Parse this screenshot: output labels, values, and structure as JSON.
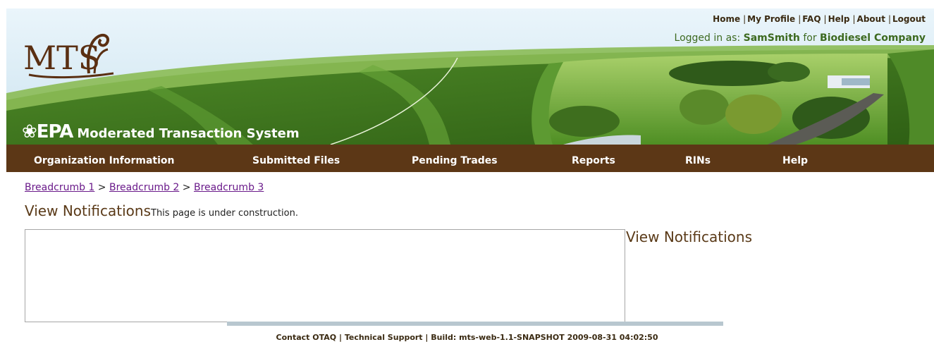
{
  "header": {
    "logo_text": "MTS",
    "agency": "EPA",
    "system_name": "Moderated Transaction System"
  },
  "top_links": [
    {
      "label": "Home"
    },
    {
      "label": "My Profile"
    },
    {
      "label": "FAQ"
    },
    {
      "label": "Help"
    },
    {
      "label": "About"
    },
    {
      "label": "Logout"
    }
  ],
  "login": {
    "prefix": "Logged in as: ",
    "user": "SamSmith",
    "middle": " for ",
    "company": "Biodiesel Company"
  },
  "nav": [
    {
      "label": "Organization Information"
    },
    {
      "label": "Submitted Files"
    },
    {
      "label": "Pending Trades"
    },
    {
      "label": "Reports"
    },
    {
      "label": "RINs"
    },
    {
      "label": "Help"
    }
  ],
  "breadcrumbs": [
    {
      "label": "Breadcrumb 1"
    },
    {
      "label": "Breadcrumb 2"
    },
    {
      "label": "Breadcrumb 3"
    }
  ],
  "breadcrumb_separator": " > ",
  "page": {
    "title": "View Notifications",
    "construction_note": "This page is under construction.",
    "side_title": "View Notifications"
  },
  "footer": {
    "contact": "Contact OTAQ",
    "support": "Technical Support",
    "build": "Build: mts-web-1.1-SNAPSHOT 2009-08-31 04:02:50",
    "separator": " | "
  },
  "colors": {
    "nav_bg": "#5c3716",
    "header_green": "#3f7a1e",
    "light_green": "#7fb04a",
    "sky": "#dceef7",
    "title_brown": "#5a3a18",
    "link_purple": "#6a1a8a"
  }
}
